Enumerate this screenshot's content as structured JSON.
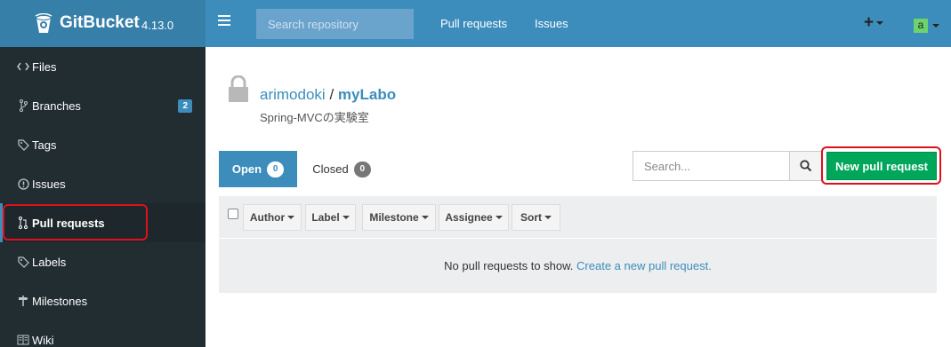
{
  "app": {
    "name": "GitBucket",
    "version": "4.13.0"
  },
  "topbar": {
    "search_placeholder": "Search repository",
    "nav": [
      {
        "label": "Pull requests"
      },
      {
        "label": "Issues"
      }
    ],
    "plus_label": "+",
    "avatar_letter": "a"
  },
  "sidebar": {
    "items": [
      {
        "label": "Files",
        "icon": "code-icon"
      },
      {
        "label": "Branches",
        "icon": "branch-icon",
        "badge": "2"
      },
      {
        "label": "Tags",
        "icon": "tag-icon"
      },
      {
        "label": "Issues",
        "icon": "issue-icon"
      },
      {
        "label": "Pull requests",
        "icon": "pull-request-icon",
        "active": true
      },
      {
        "label": "Labels",
        "icon": "tag-icon"
      },
      {
        "label": "Milestones",
        "icon": "milestone-icon"
      },
      {
        "label": "Wiki",
        "icon": "book-icon"
      }
    ]
  },
  "repo": {
    "owner": "arimodoki",
    "separator": "/",
    "name": "myLabo",
    "description": "Spring-MVCの実験室"
  },
  "tabs": {
    "open_label": "Open",
    "open_count": "0",
    "closed_label": "Closed",
    "closed_count": "0"
  },
  "search": {
    "placeholder": "Search..."
  },
  "new_pr_label": "New pull request",
  "filters": [
    {
      "label": "Author"
    },
    {
      "label": "Label"
    },
    {
      "label": "Milestone"
    },
    {
      "label": "Assignee"
    },
    {
      "label": "Sort"
    }
  ],
  "empty": {
    "text": "No pull requests to show.",
    "link": "Create a new pull request."
  },
  "colors": {
    "topbar": "#3c8dbc",
    "brand": "#367fa9",
    "sidebar": "#222d32",
    "primary": "#3c8dbc",
    "success": "#00a65a",
    "annotation": "#e0101b"
  }
}
